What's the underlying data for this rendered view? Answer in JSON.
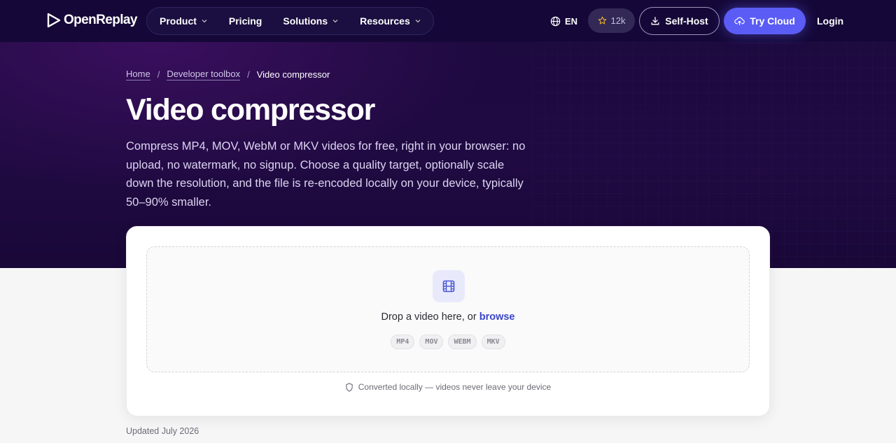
{
  "nav": {
    "brand": "OpenReplay",
    "items": [
      {
        "label": "Product",
        "has_menu": true
      },
      {
        "label": "Pricing",
        "has_menu": false
      },
      {
        "label": "Solutions",
        "has_menu": true
      },
      {
        "label": "Resources",
        "has_menu": true
      }
    ],
    "language": "EN",
    "stars": "12k",
    "self_host": "Self-Host",
    "try_cloud": "Try Cloud",
    "login": "Login"
  },
  "breadcrumb": {
    "home": "Home",
    "toolbox": "Developer toolbox",
    "current": "Video compressor",
    "separator": "/"
  },
  "hero": {
    "title": "Video compressor",
    "description": "Compress MP4, MOV, WebM or MKV videos for free, right in your browser: no upload, no watermark, no signup. Choose a quality target, optionally scale down the resolution, and the file is re-encoded locally on your device, typically 50–90% smaller."
  },
  "dropzone": {
    "prompt": "Drop a video here, or",
    "browse": "browse",
    "formats": [
      "MP4",
      "MOV",
      "WEBM",
      "MKV"
    ],
    "privacy_note": "Converted locally — videos never leave your device"
  },
  "footer": {
    "updated": "Updated July 2026"
  },
  "colors": {
    "hero_bg": "#1c0a3e",
    "accent": "#5b5cf5",
    "link": "#3b46c9"
  }
}
